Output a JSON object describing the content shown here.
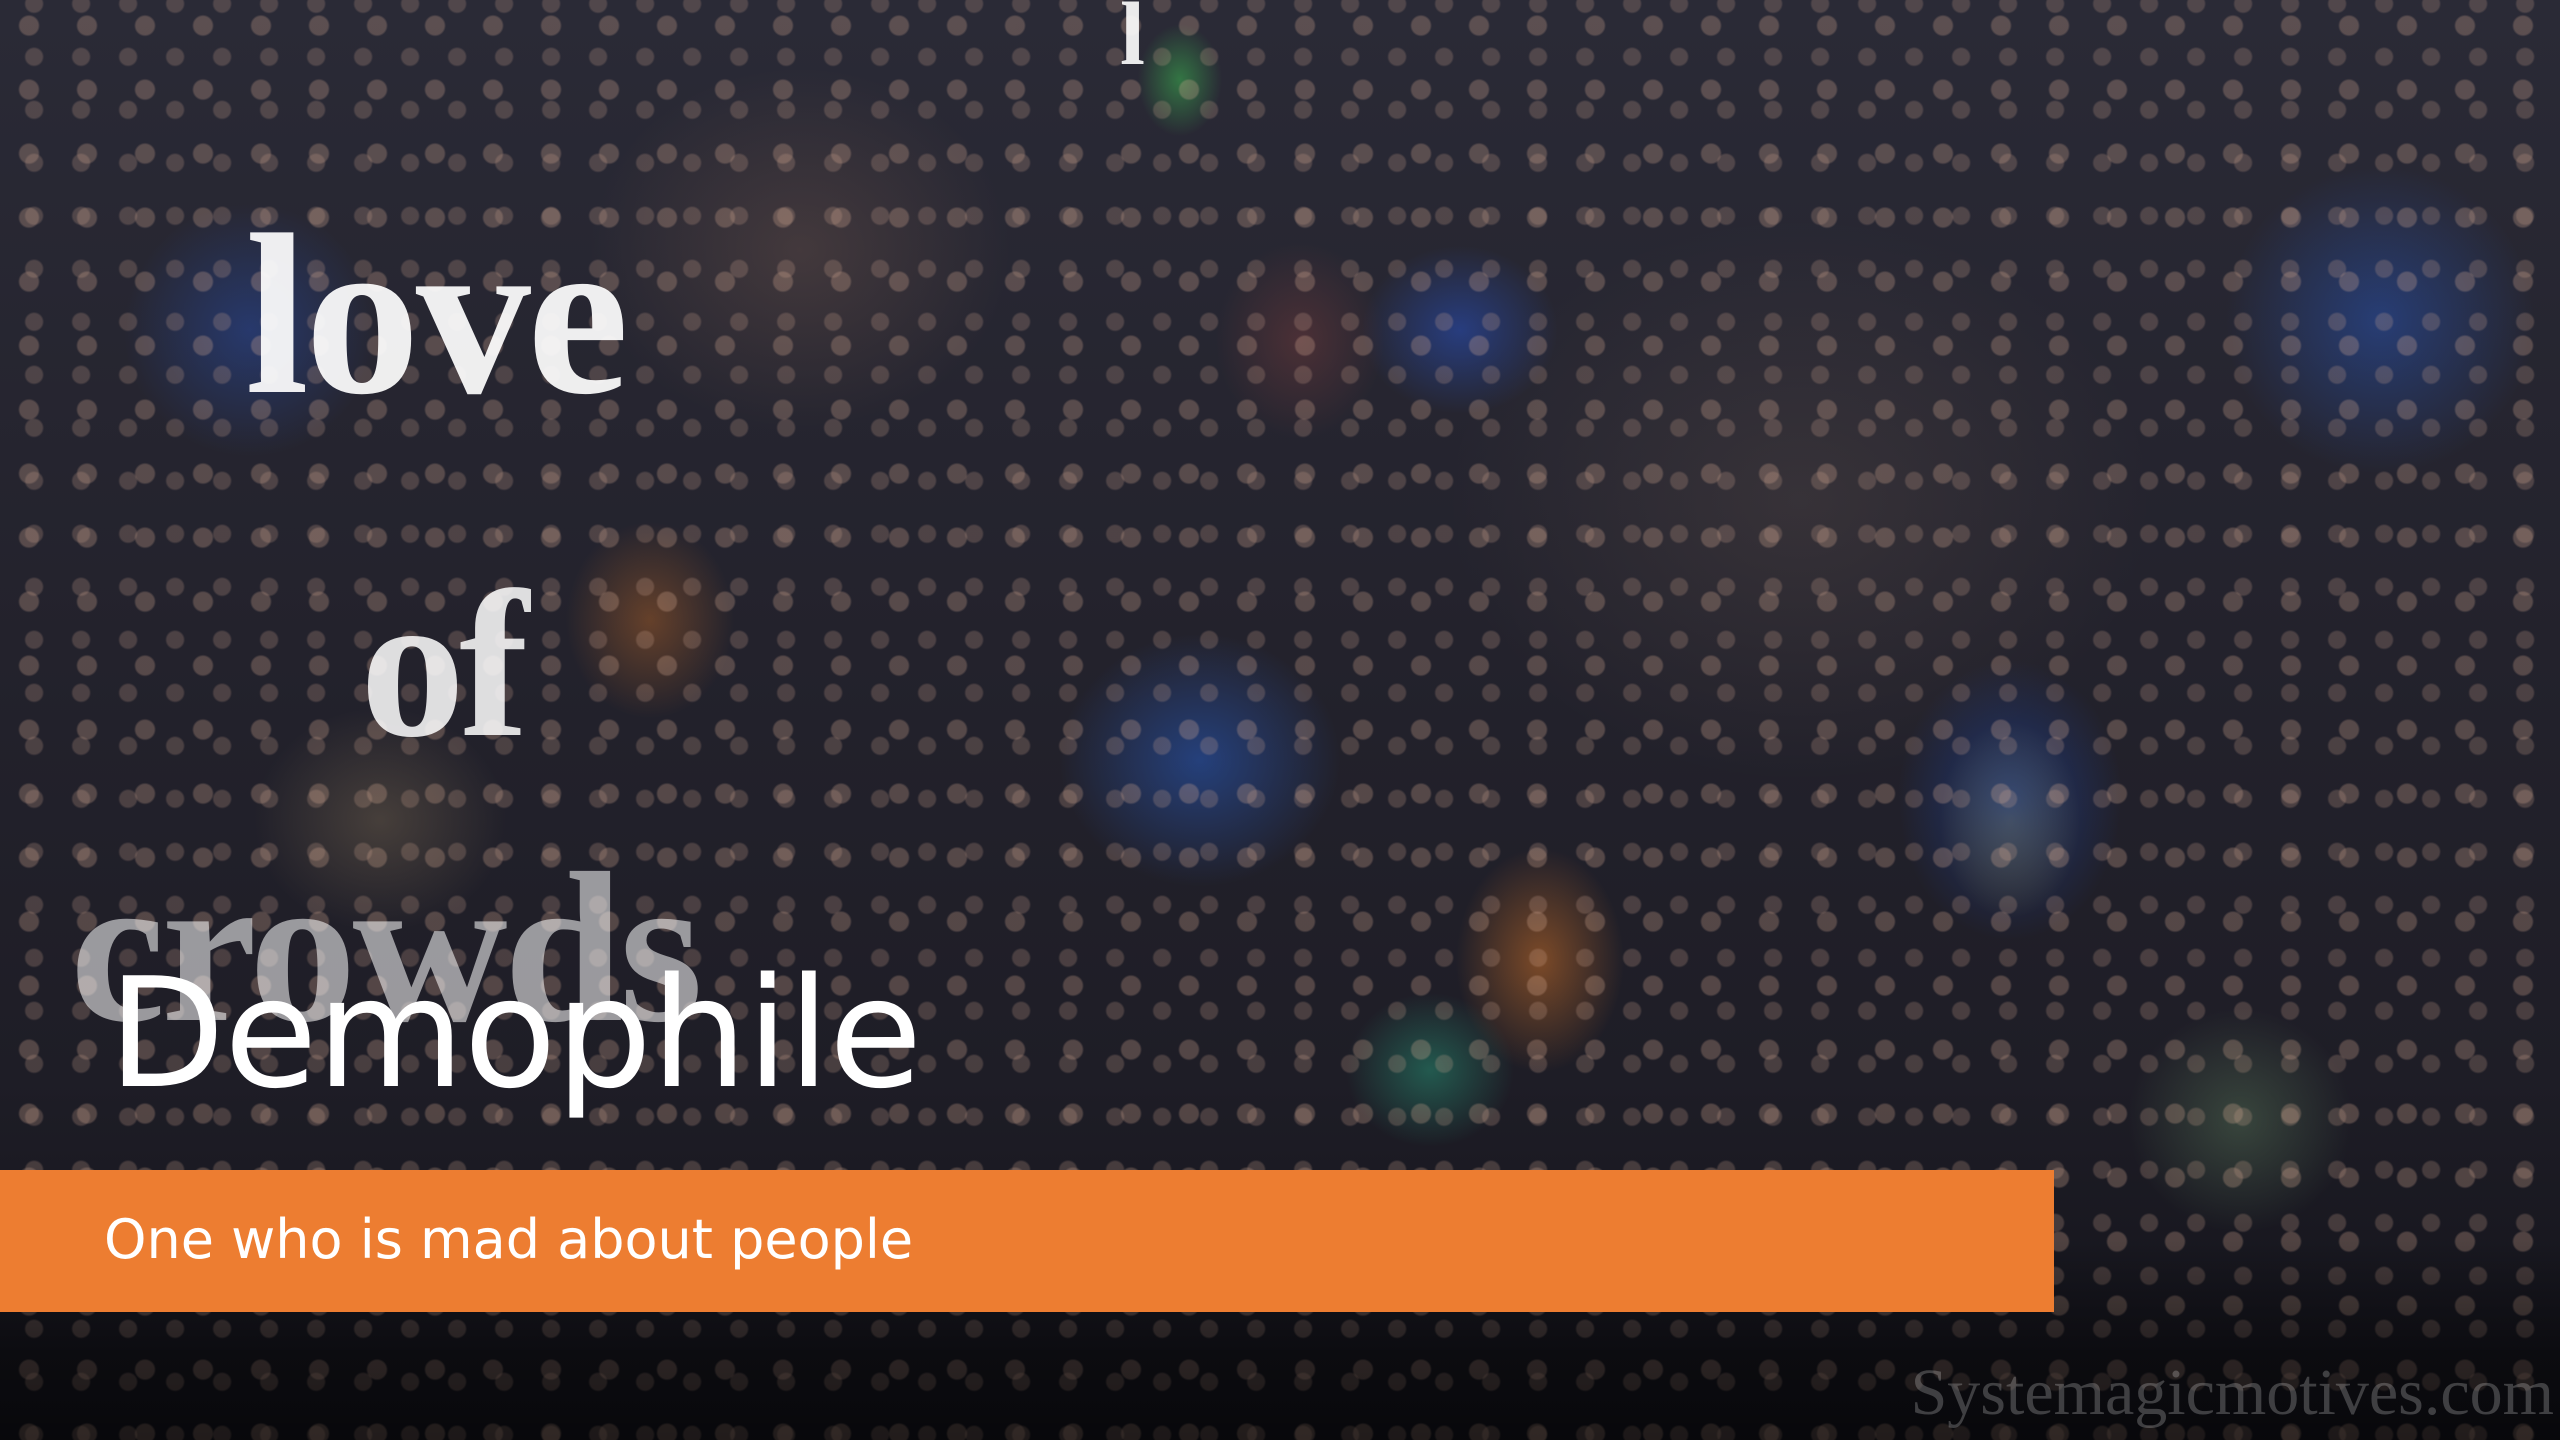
{
  "photo": {
    "overlay_text_line1": "love",
    "overlay_text_line2": "of",
    "overlay_text_line3": "crowds",
    "overlay_glyph": "l",
    "watermark": "Systemagicmotives.com"
  },
  "slide": {
    "title": "Demophile",
    "subtitle": "One who is mad about people"
  },
  "colors": {
    "banner": "#ed7d31",
    "text": "#ffffff"
  }
}
